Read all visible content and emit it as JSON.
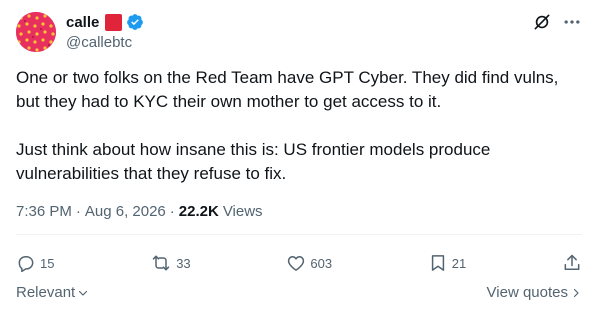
{
  "user": {
    "display_name": "calle",
    "handle": "@callebtc",
    "avatar_icon": "pattern-avatar",
    "flag_color": "#e0243a",
    "verified_icon": "verified-badge-icon",
    "verified_color": "#1d9bf0"
  },
  "tweet": {
    "paragraphs": [
      "One or two folks on the Red Team have GPT Cyber. They did find vulns, but they had to KYC their own mother to get access to it.",
      "Just think about how insane this is: US frontier models produce vulnerabilities that they refuse to fix."
    ],
    "time": "7:36 PM",
    "separator": "·",
    "date": "Aug 6, 2026",
    "views_count": "22.2K",
    "views_label": "Views"
  },
  "actions": {
    "replies": "15",
    "reposts": "33",
    "likes": "603",
    "bookmarks": "21"
  },
  "footer": {
    "sort_label": "Relevant",
    "view_quotes_label": "View quotes"
  },
  "colors": {
    "text": "#0f1419",
    "secondary": "#536471",
    "accent": "#1d9bf0"
  }
}
